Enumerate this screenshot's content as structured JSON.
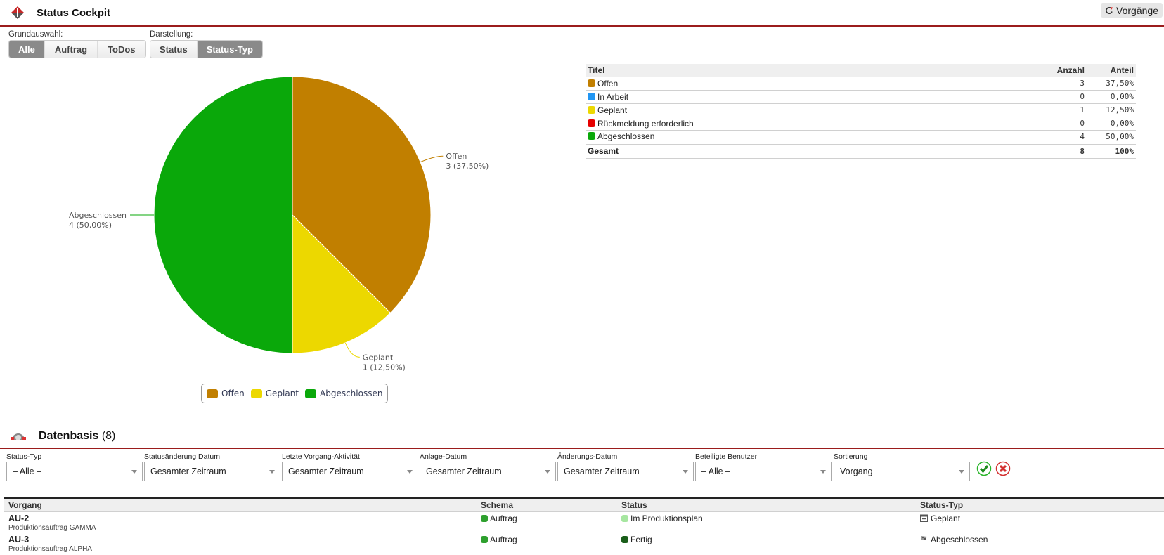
{
  "header": {
    "title": "Status Cockpit",
    "vorgaenge_button": "Vorgänge",
    "logo_icon": "app-diamond-logo-icon",
    "refresh_icon": "refresh-icon"
  },
  "grundauswahl": {
    "label": "Grundauswahl:",
    "options": [
      "Alle",
      "Auftrag",
      "ToDos"
    ],
    "selected": "Alle"
  },
  "darstellung": {
    "label": "Darstellung:",
    "options": [
      "Status",
      "Status-Typ"
    ],
    "selected": "Status-Typ"
  },
  "summary_table": {
    "headers": {
      "title": "Titel",
      "count": "Anzahl",
      "share": "Anteil"
    },
    "rows": [
      {
        "title": "Offen",
        "color": "#c17f00",
        "count": "3",
        "share": "37,50%"
      },
      {
        "title": "In Arbeit",
        "color": "#2196f3",
        "count": "0",
        "share": "0,00%"
      },
      {
        "title": "Geplant",
        "color": "#ecd800",
        "count": "1",
        "share": "12,50%"
      },
      {
        "title": "Rückmeldung erforderlich",
        "color": "#e60000",
        "count": "0",
        "share": "0,00%"
      },
      {
        "title": "Abgeschlossen",
        "color": "#0aa80a",
        "count": "4",
        "share": "50,00%"
      }
    ],
    "total": {
      "title": "Gesamt",
      "count": "8",
      "share": "100%"
    }
  },
  "chart_data": {
    "type": "pie",
    "title": "",
    "slices": [
      {
        "label": "Offen",
        "value": 3,
        "percent_label": "3 (37,50%)",
        "color": "#c17f00"
      },
      {
        "label": "Geplant",
        "value": 1,
        "percent_label": "1 (12,50%)",
        "color": "#ecd800"
      },
      {
        "label": "Abgeschlossen",
        "value": 4,
        "percent_label": "4 (50,00%)",
        "color": "#0aa80a"
      }
    ],
    "legend": {
      "position": "bottom-center",
      "entries": [
        "Offen",
        "Geplant",
        "Abgeschlossen"
      ]
    }
  },
  "datenbasis": {
    "title": "Datenbasis",
    "count": "(8)",
    "icon": "dashboard-gauge-icon",
    "filters": [
      {
        "label": "Status-Typ",
        "value": "– Alle –"
      },
      {
        "label": "Statusänderung Datum",
        "value": "Gesamter Zeitraum"
      },
      {
        "label": "Letzte Vorgang-Aktivität",
        "value": "Gesamter Zeitraum"
      },
      {
        "label": "Anlage-Datum",
        "value": "Gesamter Zeitraum"
      },
      {
        "label": "Änderungs-Datum",
        "value": "Gesamter Zeitraum"
      },
      {
        "label": "Beteiligte Benutzer",
        "value": "– Alle –"
      },
      {
        "label": "Sortierung",
        "value": "Vorgang"
      }
    ],
    "apply_icon": "check-circle-icon",
    "reset_icon": "x-circle-icon",
    "table": {
      "headers": [
        "Vorgang",
        "Schema",
        "Status",
        "Status-Typ"
      ],
      "rows": [
        {
          "id": "AU-2",
          "desc": "Produktionsauftrag GAMMA",
          "schema": "Auftrag",
          "schema_color": "#2ea02e",
          "status": "Im Produktionsplan",
          "status_color": "#a6e6a0",
          "status_type": "Geplant",
          "status_type_icon": "calendar-icon"
        },
        {
          "id": "AU-3",
          "desc": "Produktionsauftrag ALPHA",
          "schema": "Auftrag",
          "schema_color": "#2ea02e",
          "status": "Fertig",
          "status_color": "#1a5e1a",
          "status_type": "Abgeschlossen",
          "status_type_icon": "checkered-flag-icon"
        }
      ]
    }
  }
}
